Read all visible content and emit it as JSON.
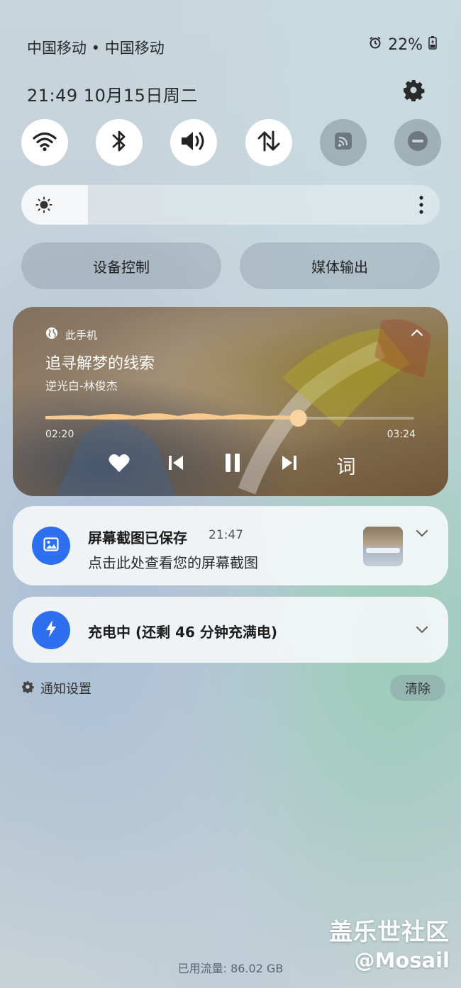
{
  "status_bar": {
    "carrier": "中国移动 • 中国移动",
    "battery": "22%",
    "alarm_icon": "alarm-icon",
    "battery_icon": "battery-charging-icon"
  },
  "header": {
    "datetime": "21:49  10月15日周二",
    "settings_icon": "gear-icon"
  },
  "quick_toggles": [
    {
      "name": "wifi",
      "icon": "wifi-icon",
      "state": "on"
    },
    {
      "name": "bluetooth",
      "icon": "bluetooth-icon",
      "state": "on"
    },
    {
      "name": "sound",
      "icon": "volume-icon",
      "state": "on"
    },
    {
      "name": "mobile-data",
      "icon": "data-transfer-icon",
      "state": "on"
    },
    {
      "name": "cast",
      "icon": "cast-icon",
      "state": "off"
    },
    {
      "name": "do-not-disturb",
      "icon": "do-not-disturb-icon",
      "state": "off"
    }
  ],
  "brightness": {
    "level": 0.16,
    "icon": "sun-icon",
    "more_icon": "more-vertical-icon"
  },
  "panel_buttons": {
    "device_control": "设备控制",
    "media_output": "媒体输出"
  },
  "media": {
    "source": "此手机",
    "title": "追寻解梦的线索",
    "artist": "逆光白-林俊杰",
    "elapsed": "02:20",
    "duration": "03:24",
    "progress": 0.686,
    "lyrics_label": "词",
    "accent": "#f7c98c"
  },
  "notifications": [
    {
      "title": "屏幕截图已保存",
      "time": "21:47",
      "body": "点击此处查看您的屏幕截图",
      "icon": "image-icon"
    },
    {
      "title": "充电中 (还剩 46 分钟充满电)",
      "icon": "lightning-icon"
    }
  ],
  "footer": {
    "notification_settings": "通知设置",
    "clear": "清除",
    "data_used": "已用流量: 86.02 GB"
  },
  "watermark": {
    "line1": "盖乐世社区",
    "line2": "@Mosail"
  },
  "colors": {
    "accent_blue": "#2e6ff0"
  }
}
